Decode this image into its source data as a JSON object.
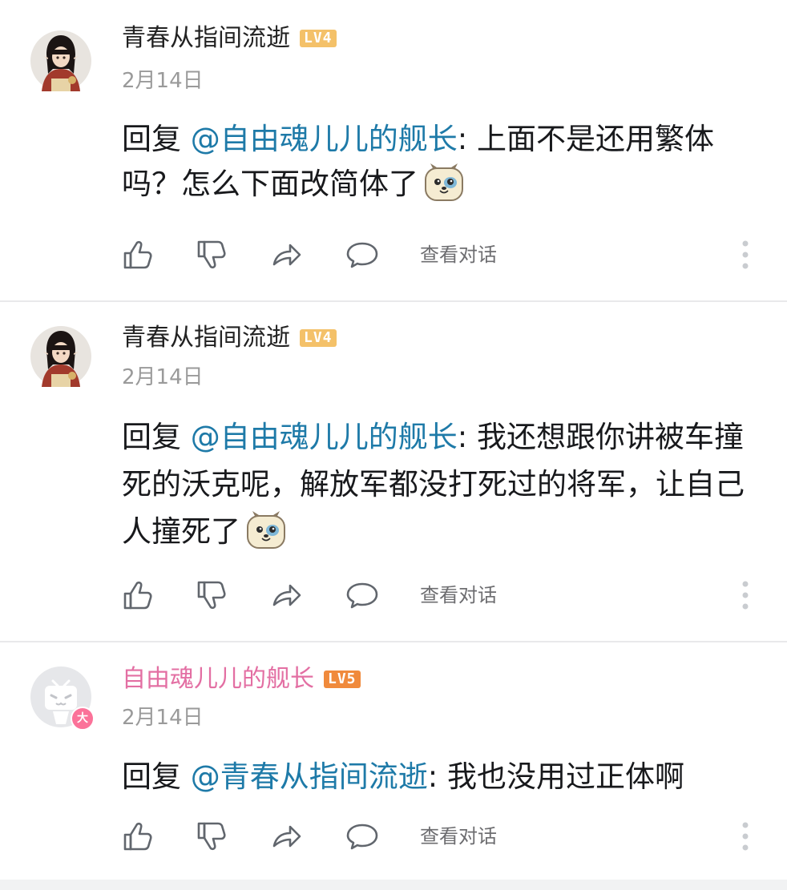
{
  "comments": [
    {
      "username": "青春从指间流逝",
      "level": "LV4",
      "date": "2月14日",
      "reply_prefix": "回复 ",
      "mention": "@自由魂儿儿的舰长",
      "body": ": 上面不是还用繁体吗？怎么下面改简体了",
      "action_view": "查看对话"
    },
    {
      "username": "青春从指间流逝",
      "level": "LV4",
      "date": "2月14日",
      "reply_prefix": "回复 ",
      "mention": "@自由魂儿儿的舰长",
      "body": ": 我还想跟你讲被车撞死的沃克呢，解放军都没打死过的将军，让自己人撞死了",
      "action_view": "查看对话"
    },
    {
      "username": "自由魂儿儿的舰长",
      "level": "LV5",
      "date": "2月14日",
      "avatar_badge": "大",
      "reply_prefix": "回复 ",
      "mention": "@青春从指间流逝",
      "body": ": 我也没用过正体啊",
      "action_view": "查看对话"
    }
  ],
  "icons": {
    "like": "thumb-up-icon",
    "dislike": "thumb-down-icon",
    "share": "share-arrow-icon",
    "reply": "comment-bubble-icon",
    "more": "more-vertical-icon",
    "emote": "dog-face-emote-icon"
  },
  "colors": {
    "mention": "#1e7aa8",
    "vip_name": "#e36fa3",
    "lv4": "#f4c169",
    "lv5": "#f08a3c"
  }
}
